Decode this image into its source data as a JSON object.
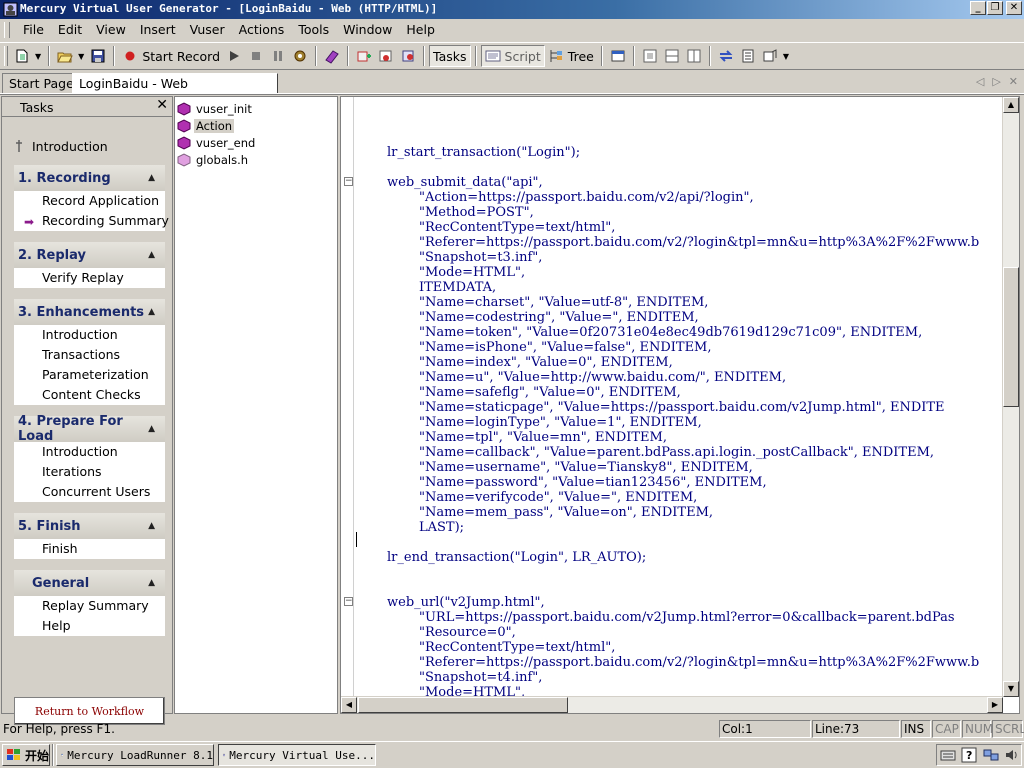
{
  "window": {
    "title": "Mercury Virtual User Generator - [LoginBaidu - Web (HTTP/HTML)]",
    "controls": [
      "_",
      "❐",
      "✕"
    ]
  },
  "menu": [
    "File",
    "Edit",
    "View",
    "Insert",
    "Vuser",
    "Actions",
    "Tools",
    "Window",
    "Help"
  ],
  "toolbar": {
    "start_record": "Start Record",
    "tasks": "Tasks",
    "script": "Script",
    "tree": "Tree"
  },
  "tabs": [
    "Start Page",
    "LoginBaidu - Web (HTTP/HTML)"
  ],
  "tasks_pane": {
    "title": "Tasks",
    "close": "✕",
    "intro": "Introduction",
    "groups": [
      {
        "title": "1. Recording",
        "items": [
          "Record Application",
          "Recording Summary"
        ]
      },
      {
        "title": "2. Replay",
        "items": [
          "Verify Replay"
        ]
      },
      {
        "title": "3. Enhancements",
        "items": [
          "Introduction",
          "Transactions",
          "Parameterization",
          "Content Checks"
        ]
      },
      {
        "title": "4. Prepare For Load",
        "items": [
          "Introduction",
          "Iterations",
          "Concurrent Users"
        ]
      },
      {
        "title": "5. Finish",
        "items": [
          "Finish"
        ]
      },
      {
        "title": "General",
        "items": [
          "Replay Summary",
          "Help"
        ]
      }
    ],
    "return_button": "Return to Workflow"
  },
  "tree": [
    "vuser_init",
    "Action",
    "vuser_end",
    "globals.h"
  ],
  "code_lines": [
    "lr_start_transaction(\"Login\");",
    "web_submit_data(\"api\",",
    "\"Action=https://passport.baidu.com/v2/api/?login\",",
    "\"Method=POST\",",
    "\"RecContentType=text/html\",",
    "\"Referer=https://passport.baidu.com/v2/?login&tpl=mn&u=http%3A%2F%2Fwww.b",
    "\"Snapshot=t3.inf\",",
    "\"Mode=HTML\",",
    "ITEMDATA,",
    "\"Name=charset\", \"Value=utf-8\", ENDITEM,",
    "\"Name=codestring\", \"Value=\", ENDITEM,",
    "\"Name=token\", \"Value=0f20731e04e8ec49db7619d129c71c09\", ENDITEM,",
    "\"Name=isPhone\", \"Value=false\", ENDITEM,",
    "\"Name=index\", \"Value=0\", ENDITEM,",
    "\"Name=u\", \"Value=http://www.baidu.com/\", ENDITEM,",
    "\"Name=safeflg\", \"Value=0\", ENDITEM,",
    "\"Name=staticpage\", \"Value=https://passport.baidu.com/v2Jump.html\", ENDITE",
    "\"Name=loginType\", \"Value=1\", ENDITEM,",
    "\"Name=tpl\", \"Value=mn\", ENDITEM,",
    "\"Name=callback\", \"Value=parent.bdPass.api.login._postCallback\", ENDITEM,",
    "\"Name=username\", \"Value=Tiansky8\", ENDITEM,",
    "\"Name=password\", \"Value=tian123456\", ENDITEM,",
    "\"Name=verifycode\", \"Value=\", ENDITEM,",
    "\"Name=mem_pass\", \"Value=on\", ENDITEM,",
    "LAST);",
    "lr_end_transaction(\"Login\", LR_AUTO);",
    "web_url(\"v2Jump.html\",",
    "\"URL=https://passport.baidu.com/v2Jump.html?error=0&callback=parent.bdPas",
    "\"Resource=0\",",
    "\"RecContentType=text/html\",",
    "\"Referer=https://passport.baidu.com/v2/?login&tpl=mn&u=http%3A%2F%2Fwww.b",
    "\"Snapshot=t4.inf\",",
    "\"Mode=HTML\","
  ],
  "status": {
    "help": "For Help, press F1.",
    "col": "Col:1",
    "line": "Line:73",
    "ins": "INS",
    "cap": "CAP",
    "num": "NUM",
    "scrl": "SCRL"
  },
  "taskbar": {
    "start": "开始",
    "items": [
      "Mercury LoadRunner 8.1",
      "Mercury Virtual Use..."
    ]
  }
}
